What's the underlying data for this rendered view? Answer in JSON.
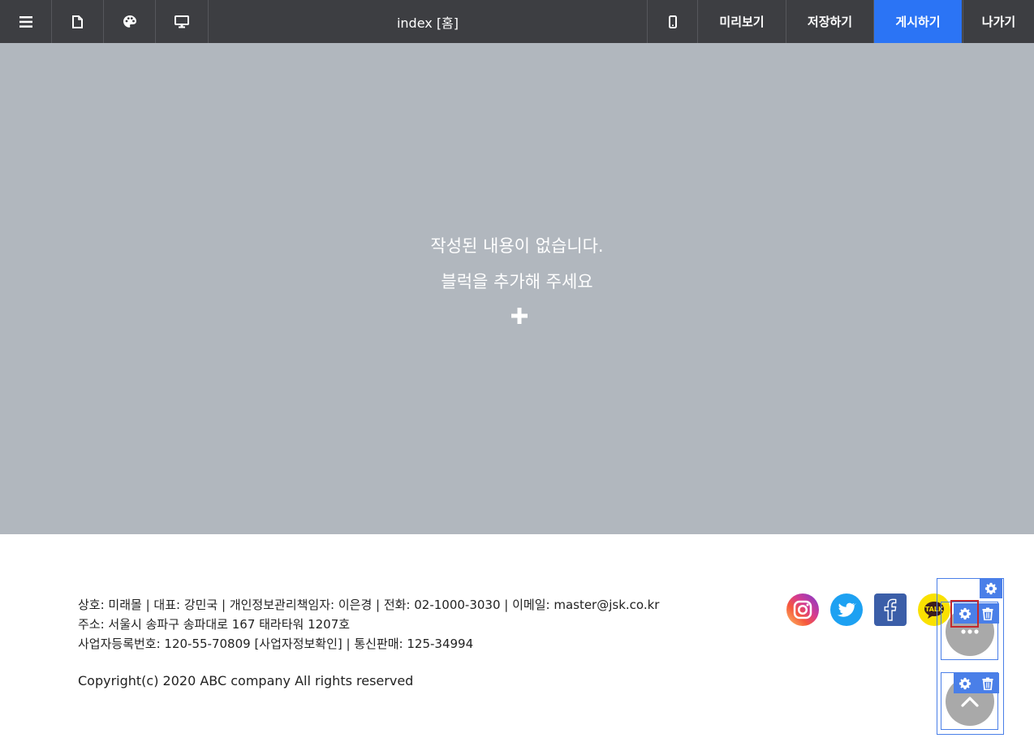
{
  "toolbar": {
    "menu_icon": "hamburger-icon",
    "page_icon": "page-icon",
    "design_icon": "palette-icon",
    "desktop_icon": "desktop-icon",
    "mobile_icon": "mobile-icon",
    "title": "index [홈]",
    "preview_label": "미리보기",
    "save_label": "저장하기",
    "publish_label": "게시하기",
    "exit_label": "나가기",
    "accent_color": "#2b74f5"
  },
  "canvas": {
    "empty_line1": "작성된 내용이 없습니다.",
    "empty_line2": "블럭을 추가해 주세요",
    "add_icon": "plus-icon"
  },
  "footer": {
    "line1": "상호: 미래몰 | 대표: 강민국 | 개인정보관리책임자: 이은경 | 전화: 02-1000-3030 | 이메일: master@jsk.co.kr",
    "line2": "주소: 서울시 송파구 송파대로 167 태라타워 1207호",
    "line3": "사업자등록번호: 120-55-70809 [사업자정보확인] | 통신판매: 125-34994",
    "copyright": "Copyright(c) 2020 ABC company All rights reserved",
    "social": [
      "instagram",
      "twitter",
      "facebook",
      "kakaotalk"
    ],
    "kakao_text": "TALK"
  }
}
